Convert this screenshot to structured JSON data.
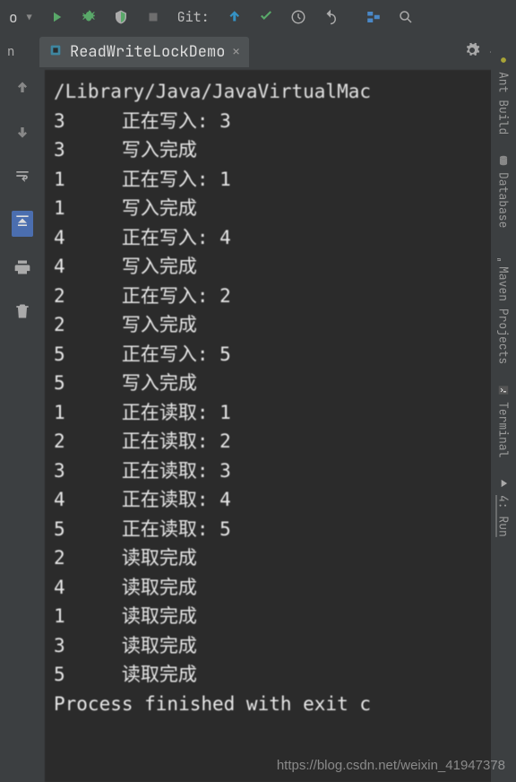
{
  "toolbar": {
    "git_label": "Git:"
  },
  "tab": {
    "title": "ReadWriteLockDemo"
  },
  "console": {
    "header": "/Library/Java/JavaVirtualMac",
    "lines": [
      "3     正在写入: 3",
      "3     写入完成",
      "1     正在写入: 1",
      "1     写入完成",
      "4     正在写入: 4",
      "4     写入完成",
      "2     正在写入: 2",
      "2     写入完成",
      "5     正在写入: 5",
      "5     写入完成",
      "1     正在读取: 1",
      "2     正在读取: 2",
      "3     正在读取: 3",
      "4     正在读取: 4",
      "5     正在读取: 5",
      "2     读取完成",
      "4     读取完成",
      "1     读取完成",
      "3     读取完成",
      "5     读取完成",
      "",
      "Process finished with exit c"
    ]
  },
  "right_tabs": {
    "ant": "Ant Build",
    "database": "Database",
    "maven": "Maven Projects",
    "terminal": "Terminal",
    "run": "4: Run"
  },
  "watermark": "https://blog.csdn.net/weixin_41947378"
}
